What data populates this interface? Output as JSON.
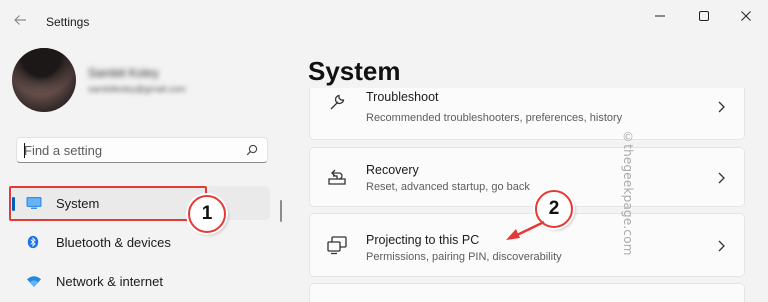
{
  "window": {
    "title": "Settings",
    "controls": [
      "minimize-icon",
      "maximize-icon",
      "close-icon"
    ]
  },
  "profile": {
    "name": "Sambit Koley",
    "email": "sambitkoley@gmail.com"
  },
  "search": {
    "placeholder": "Find a setting",
    "icon": "search-icon"
  },
  "nav": {
    "items": [
      {
        "label": "System",
        "icon": "monitor-icon",
        "selected": true
      },
      {
        "label": "Bluetooth & devices",
        "icon": "bluetooth-icon",
        "selected": false
      },
      {
        "label": "Network & internet",
        "icon": "wifi-icon",
        "selected": false
      }
    ]
  },
  "main": {
    "title": "System",
    "cards": [
      {
        "title": "Troubleshoot",
        "desc": "Recommended troubleshooters, preferences, history",
        "icon": "wrench-icon"
      },
      {
        "title": "Recovery",
        "desc": "Reset, advanced startup, go back",
        "icon": "recovery-icon"
      },
      {
        "title": "Projecting to this PC",
        "desc": "Permissions, pairing PIN, discoverability",
        "icon": "projecting-icon"
      }
    ]
  },
  "annotations": {
    "callout_1": "1",
    "callout_2": "2",
    "color": "#e53935"
  },
  "watermark": "©thegeekpage.com",
  "colors": {
    "accent": "#005fb8",
    "window_bg": "#f3f3f3",
    "card_bg": "#fbfbfb"
  }
}
